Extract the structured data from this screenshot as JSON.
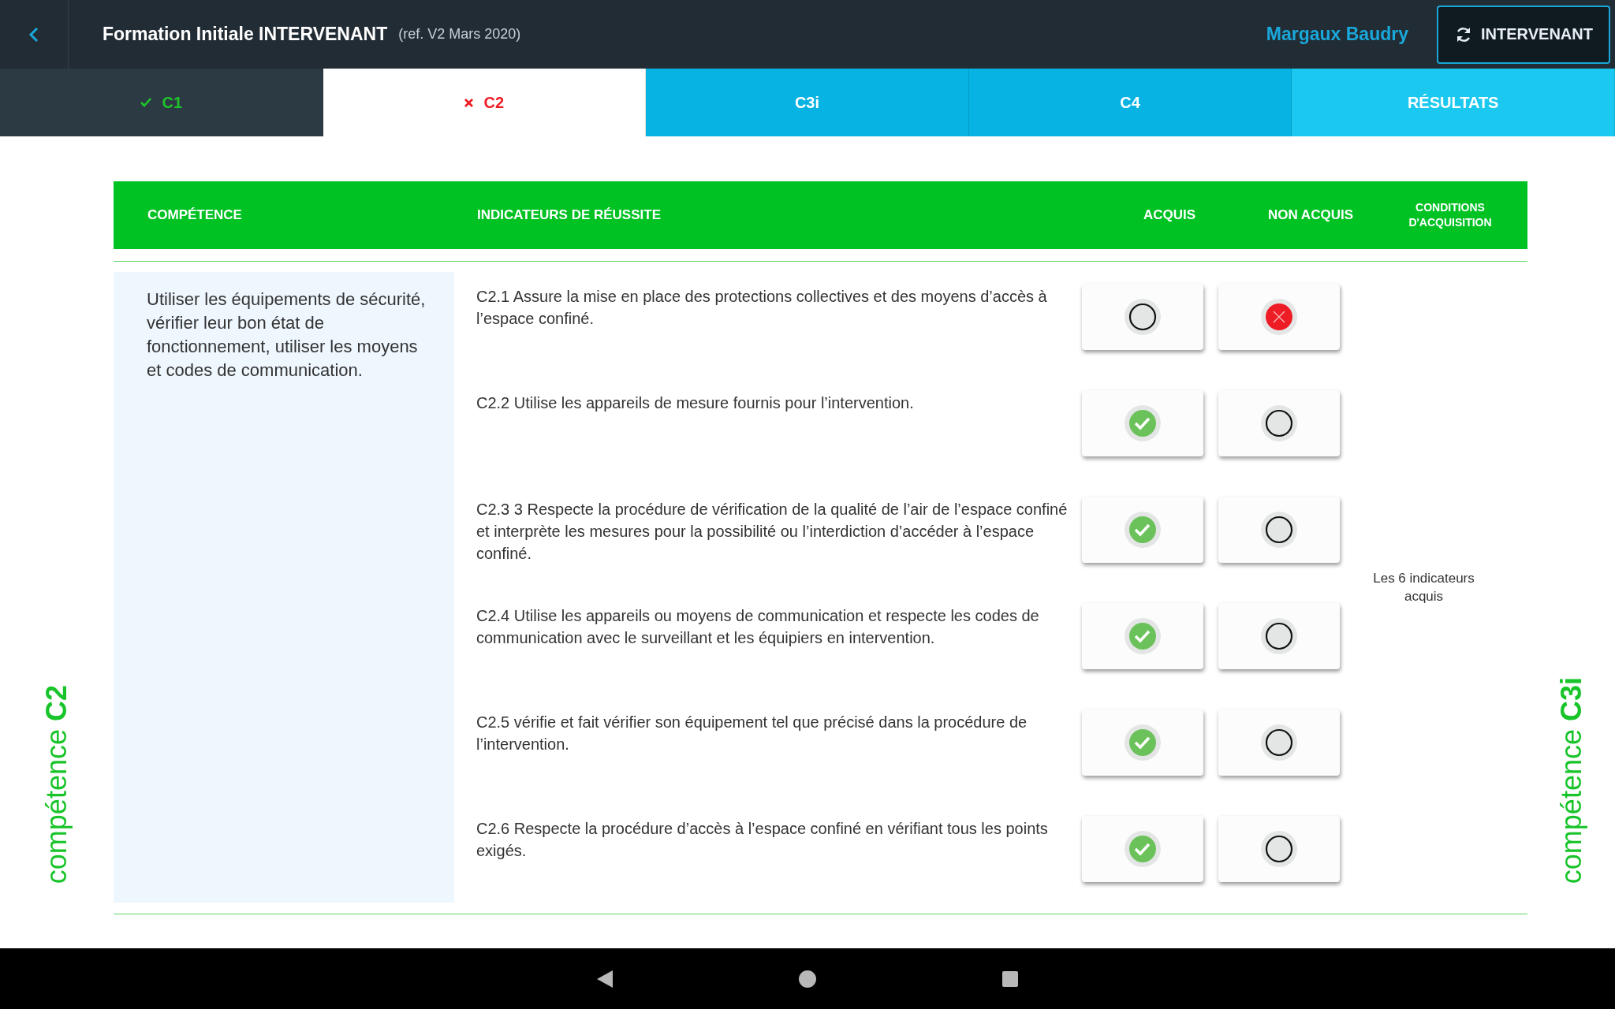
{
  "header": {
    "title": "Formation Initiale INTERVENANT",
    "reference": "(ref. V2 Mars 2020)",
    "user": "Margaux Baudry",
    "role_button": "INTERVENANT"
  },
  "tabs": [
    {
      "label": "C1",
      "kind": "competence",
      "passed": true,
      "failed": false,
      "selected": false
    },
    {
      "label": "C2",
      "kind": "competence",
      "passed": false,
      "failed": true,
      "selected": true
    },
    {
      "label": "C3i",
      "kind": "competence",
      "passed": false,
      "failed": false,
      "selected": false
    },
    {
      "label": "C4",
      "kind": "competence",
      "passed": false,
      "failed": false,
      "selected": false
    },
    {
      "label": "RÉSULTATS",
      "kind": "results",
      "passed": false,
      "failed": false,
      "selected": false
    }
  ],
  "side_labels": {
    "left": "compétence **C2**",
    "right": "compétence **C3i**"
  },
  "table": {
    "columns": [
      "COMPÉTENCE",
      "INDICATEURS DE RÉUSSITE",
      "ACQUIS",
      "NON ACQUIS",
      "CONDITIONS D'ACQUISITION"
    ],
    "competence": "Utiliser les équipements de sécurité, vérifier leur bon état de fonctionnement, utiliser les moyens et codes de communication.",
    "conditions": "Les 6 indicateurs acquis",
    "rows": [
      {
        "indicator": "C2.1 Assure la mise en place des protections collectives et des moyens d’accès à l’espace confiné.",
        "acquis": false,
        "non_acquis": true
      },
      {
        "indicator": "C2.2 Utilise les appareils de mesure fournis pour l’intervention.",
        "acquis": true,
        "non_acquis": false
      },
      {
        "indicator": "C2.3 3 Respecte la procédure de vérification de la qualité de l’air de l’espace confiné et interprète les mesures pour la possibilité ou l’interdiction d’accéder à l’espace confiné.",
        "acquis": true,
        "non_acquis": false
      },
      {
        "indicator": "C2.4 Utilise les appareils ou moyens de communication et respecte les codes de communication avec le surveillant et les équipiers en intervention.",
        "acquis": true,
        "non_acquis": false
      },
      {
        "indicator": "C2.5 vérifie et fait vérifier son équipement tel que précisé dans la procédure de l’intervention.",
        "acquis": true,
        "non_acquis": false
      },
      {
        "indicator": "C2.6 Respecte la procédure d’accès à l’espace confiné en vérifiant tous les points exigés.",
        "acquis": true,
        "non_acquis": false
      }
    ]
  }
}
